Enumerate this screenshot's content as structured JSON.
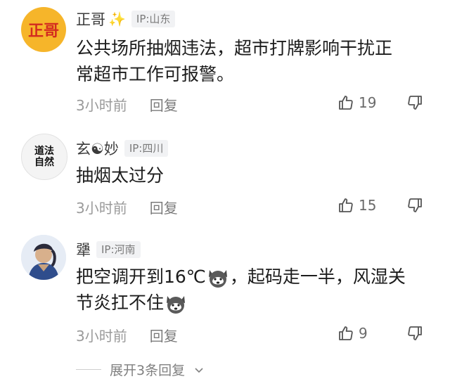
{
  "comments": [
    {
      "avatar_text": "正哥",
      "username": "正哥",
      "has_sparkle": true,
      "ip": "IP:山东",
      "text_lines": [
        "公共场所抽烟违法，超市打牌影响干扰正",
        "常超市工作可报警。"
      ],
      "time": "3小时前",
      "reply": "回复",
      "likes": "19"
    },
    {
      "avatar_text": "道法自然",
      "username": "玄☯妙",
      "ip": "IP:四川",
      "text_lines": [
        "抽烟太过分"
      ],
      "time": "3小时前",
      "reply": "回复",
      "likes": "15"
    },
    {
      "username": "犟",
      "ip": "IP:河南",
      "text_lines": [
        "把空调开到16℃",
        "，起码走一半，风湿关",
        "节炎扛不住"
      ],
      "time": "3小时前",
      "reply": "回复",
      "likes": "9"
    }
  ],
  "expand_replies": "展开3条回复",
  "icons": {
    "like": "thumbs-up-icon",
    "dislike": "thumbs-down-icon",
    "expand": "chevron-down-icon",
    "emoji": "husky-emoji-icon"
  },
  "colors": {
    "avatar1_bg": "#f6b52a",
    "avatar1_text": "#d32b1f",
    "secondary_text": "#9a9a9a"
  }
}
